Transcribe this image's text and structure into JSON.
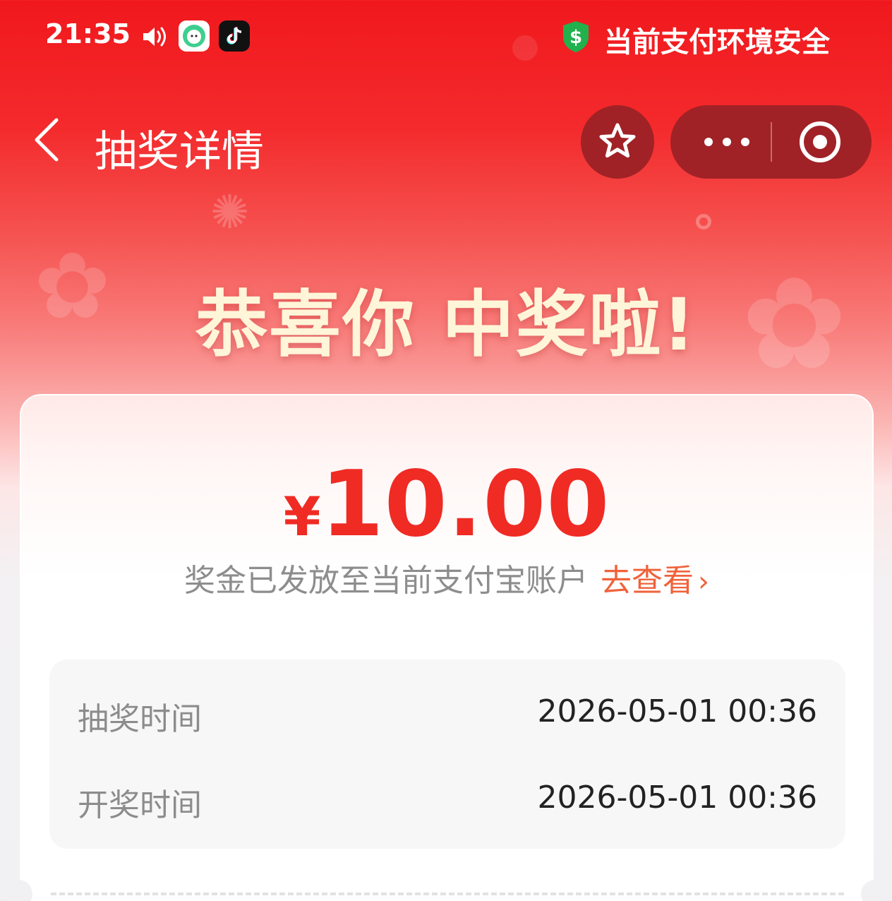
{
  "status_bar": {
    "time": "21:35",
    "icons": [
      "speaker-icon",
      "messaging-app-icon",
      "tiktok-icon"
    ],
    "security_icon": "shield-dollar-icon",
    "security_text": "当前支付环境安全"
  },
  "nav": {
    "back_icon": "chevron-left-icon",
    "title": "抽奖详情",
    "favorite_icon": "star-icon",
    "more_icon": "more-dots-icon",
    "close_icon": "target-circle-icon"
  },
  "banner": {
    "headline": "恭喜你 中奖啦!"
  },
  "prize": {
    "currency": "¥",
    "amount": "10.00",
    "notice": "奖金已发放至当前支付宝账户",
    "link_label": "去查看",
    "link_chevron": "›"
  },
  "details": [
    {
      "label": "抽奖时间",
      "value": "2026-05-01 00:36"
    },
    {
      "label": "开奖时间",
      "value": "2026-05-01 00:36"
    }
  ],
  "colors": {
    "primary_red": "#ef2b24",
    "header_red": "#f0181d",
    "capsule": "#a02226",
    "link_orange": "#f0623a",
    "headline_cream": "#fff5d9",
    "security_green": "#22b14c"
  }
}
